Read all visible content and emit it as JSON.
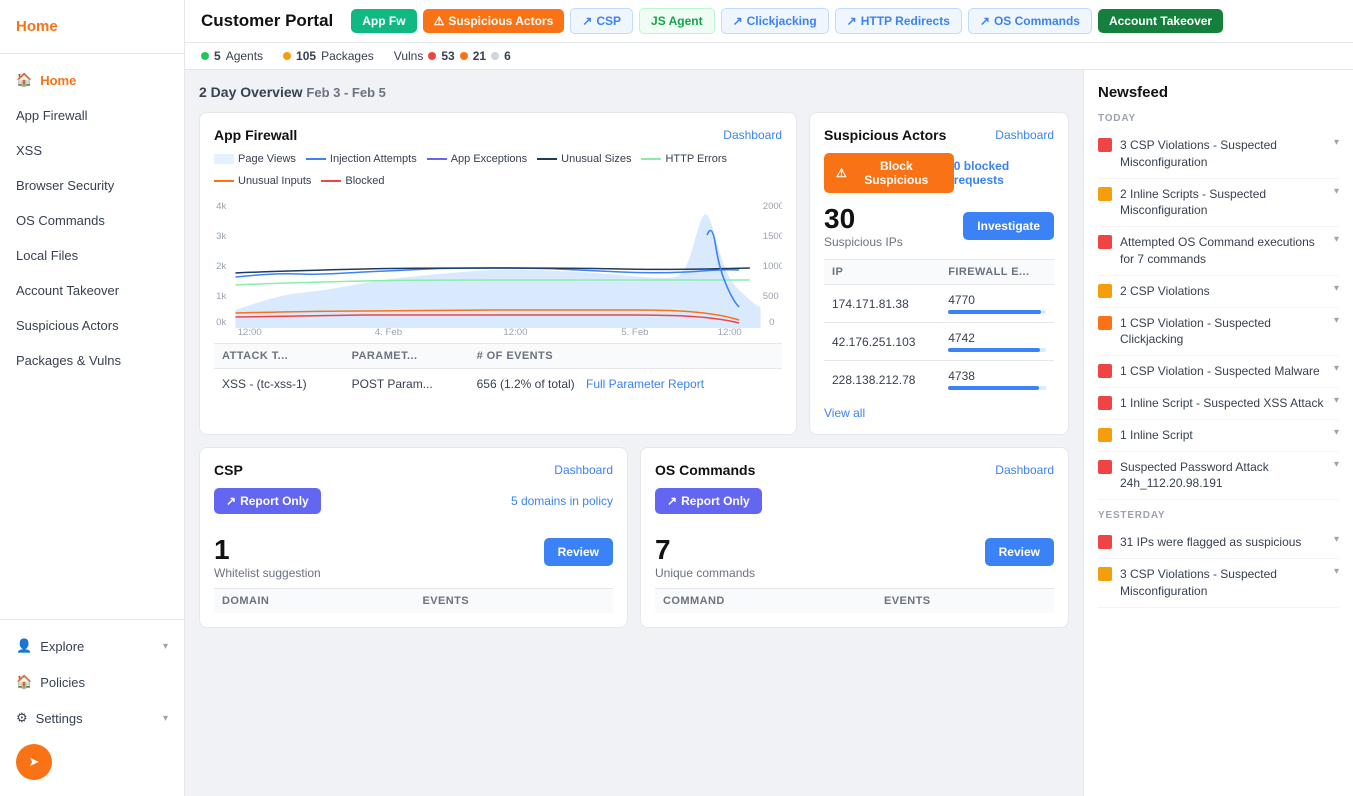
{
  "sidebar": {
    "logo": "Home",
    "nav": [
      {
        "id": "app-firewall",
        "label": "App Firewall",
        "active": false
      },
      {
        "id": "xss",
        "label": "XSS",
        "active": false
      },
      {
        "id": "browser-security",
        "label": "Browser Security",
        "active": false
      },
      {
        "id": "os-commands",
        "label": "OS Commands",
        "active": false
      },
      {
        "id": "local-files",
        "label": "Local Files",
        "active": false
      },
      {
        "id": "account-takeover",
        "label": "Account Takeover",
        "active": false
      },
      {
        "id": "suspicious-actors",
        "label": "Suspicious Actors",
        "active": false
      },
      {
        "id": "packages-vulns",
        "label": "Packages & Vulns",
        "active": false
      }
    ],
    "bottom": [
      {
        "id": "explore",
        "label": "Explore",
        "hasArrow": true
      },
      {
        "id": "policies",
        "label": "Policies"
      },
      {
        "id": "settings",
        "label": "Settings",
        "hasArrow": true
      }
    ]
  },
  "topbar": {
    "title": "Customer Portal",
    "tabs": [
      {
        "id": "app-fw",
        "label": "App Fw",
        "style": "active-green"
      },
      {
        "id": "suspicious-actors",
        "label": "Suspicious Actors",
        "style": "orange",
        "icon": "⚠"
      },
      {
        "id": "csp",
        "label": "CSP",
        "style": "blue-outline",
        "icon": "↗"
      },
      {
        "id": "js-agent",
        "label": "JS Agent",
        "style": "green-outline"
      },
      {
        "id": "clickjacking",
        "label": "Clickjacking",
        "style": "blue-outline",
        "icon": "↗"
      },
      {
        "id": "http-redirects",
        "label": "HTTP Redirects",
        "style": "blue-outline",
        "icon": "↗"
      },
      {
        "id": "os-commands",
        "label": "OS Commands",
        "style": "blue-outline",
        "icon": "↗"
      },
      {
        "id": "account-takeover",
        "label": "Account Takeover",
        "style": "dark-green"
      }
    ]
  },
  "statusbar": {
    "agents": {
      "count": "5",
      "label": "Agents",
      "color": "green"
    },
    "packages": {
      "count": "105",
      "label": "Packages",
      "color": "yellow"
    },
    "vulns_label": "Vulns",
    "vuln_red": "53",
    "vuln_orange": "21",
    "vuln_gray": "6"
  },
  "overview": {
    "label": "2 Day Overview",
    "date_range": "Feb 3 - Feb 5"
  },
  "app_firewall_card": {
    "title": "App Firewall",
    "dashboard_link": "Dashboard",
    "legend": [
      {
        "id": "page-views",
        "label": "Page Views",
        "type": "area",
        "color": "#bfdbfe"
      },
      {
        "id": "injection-attempts",
        "label": "Injection Attempts",
        "type": "line",
        "color": "#3b82f6"
      },
      {
        "id": "app-exceptions",
        "label": "App Exceptions",
        "type": "line",
        "color": "#6366f1"
      },
      {
        "id": "unusual-sizes",
        "label": "Unusual Sizes",
        "type": "line",
        "color": "#1e3a5f"
      },
      {
        "id": "http-errors",
        "label": "HTTP Errors",
        "type": "line",
        "color": "#86efac"
      },
      {
        "id": "unusual-inputs",
        "label": "Unusual Inputs",
        "type": "line",
        "color": "#f97316"
      },
      {
        "id": "blocked",
        "label": "Blocked",
        "type": "line",
        "color": "#ef4444"
      }
    ],
    "x_labels": [
      "12:00",
      "4. Feb",
      "12:00",
      "5. Feb",
      "12:00"
    ],
    "y_labels_left": [
      "4k",
      "3k",
      "2k",
      "1k",
      "0k"
    ],
    "y_labels_right": [
      "2000",
      "1500",
      "1000",
      "500",
      "0"
    ],
    "attack_table": {
      "columns": [
        "ATTACK T...",
        "PARAMET...",
        "# OF EVENTS"
      ],
      "rows": [
        {
          "attack_type": "XSS - (tc-xss-1)",
          "parameter": "POST Param...",
          "events": "656 (1.2% of total)",
          "link": "Full Parameter Report"
        }
      ]
    }
  },
  "suspicious_actors_card": {
    "title": "Suspicious Actors",
    "dashboard_link": "Dashboard",
    "block_btn": "Block Suspicious",
    "blocked_requests": "0 blocked requests",
    "count": "30",
    "count_label": "Suspicious IPs",
    "investigate_btn": "Investigate",
    "ip_table": {
      "columns": [
        "IP",
        "FIREWALL E..."
      ],
      "rows": [
        {
          "ip": "174.171.81.38",
          "events": "4770",
          "bar_pct": 95
        },
        {
          "ip": "42.176.251.103",
          "events": "4742",
          "bar_pct": 94
        },
        {
          "ip": "228.138.212.78",
          "events": "4738",
          "bar_pct": 93
        }
      ]
    },
    "view_all": "View all"
  },
  "csp_card": {
    "title": "CSP",
    "dashboard_link": "Dashboard",
    "report_btn": "Report Only",
    "policy_link": "5 domains in policy",
    "count": "1",
    "count_label": "Whitelist suggestion",
    "review_btn": "Review",
    "table": {
      "columns": [
        "DOMAIN",
        "EVENTS"
      ]
    }
  },
  "os_commands_card": {
    "title": "OS Commands",
    "dashboard_link": "Dashboard",
    "report_btn": "Report Only",
    "count": "7",
    "count_label": "Unique commands",
    "review_btn": "Review",
    "table": {
      "columns": [
        "COMMAND",
        "EVENTS"
      ]
    }
  },
  "newsfeed": {
    "title": "Newsfeed",
    "today_label": "TODAY",
    "yesterday_label": "YESTERDAY",
    "items_today": [
      {
        "id": "nf1",
        "color": "red",
        "text": "3 CSP Violations - Suspected Misconfiguration"
      },
      {
        "id": "nf2",
        "color": "yellow",
        "text": "2 Inline Scripts - Suspected Misconfiguration"
      },
      {
        "id": "nf3",
        "color": "red",
        "text": "Attempted OS Command executions for 7 commands"
      },
      {
        "id": "nf4",
        "color": "yellow",
        "text": "2 CSP Violations"
      },
      {
        "id": "nf5",
        "color": "orange",
        "text": "1 CSP Violation - Suspected Clickjacking"
      },
      {
        "id": "nf6",
        "color": "red",
        "text": "1 CSP Violation - Suspected Malware"
      },
      {
        "id": "nf7",
        "color": "red",
        "text": "1 Inline Script - Suspected XSS Attack"
      },
      {
        "id": "nf8",
        "color": "yellow",
        "text": "1 Inline Script"
      },
      {
        "id": "nf9",
        "color": "red",
        "text": "Suspected Password Attack 24h_112.20.98.191"
      }
    ],
    "items_yesterday": [
      {
        "id": "nf10",
        "color": "red",
        "text": "31 IPs were flagged as suspicious"
      },
      {
        "id": "nf11",
        "color": "yellow",
        "text": "3 CSP Violations - Suspected Misconfiguration"
      }
    ]
  }
}
